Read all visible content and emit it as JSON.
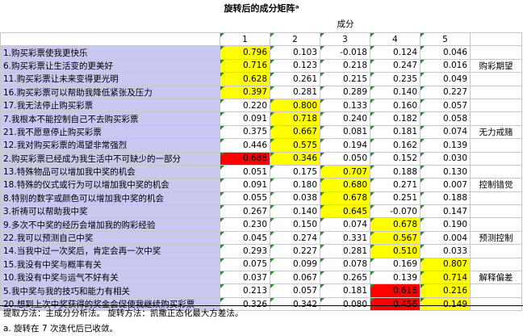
{
  "title": "旋转后的成分矩阵ᵃ",
  "group_header": "成分",
  "components": [
    "1",
    "2",
    "3",
    "4",
    "5"
  ],
  "groups": [
    {
      "name": "购彩期望",
      "rows": [
        {
          "label": "1.购买彩票使我更快乐",
          "values": [
            "0.796",
            "0.103",
            "-0.018",
            "0.124",
            "0.046"
          ],
          "highlight": [
            "y",
            "",
            "",
            "",
            ""
          ]
        },
        {
          "label": "6.购买彩票让生活变的更美好",
          "values": [
            "0.716",
            "0.123",
            "0.218",
            "0.247",
            "0.016"
          ],
          "highlight": [
            "y",
            "",
            "",
            "",
            ""
          ]
        },
        {
          "label": "11.购买彩票让未来变得更光明",
          "values": [
            "0.628",
            "0.261",
            "0.215",
            "0.235",
            "0.049"
          ],
          "highlight": [
            "y",
            "",
            "",
            "",
            ""
          ]
        },
        {
          "label": "16.购买彩票可以帮助我降低紧张及压力",
          "values": [
            "0.397",
            "0.281",
            "0.289",
            "0.140",
            "0.227"
          ],
          "highlight": [
            "y",
            "",
            "",
            "",
            ""
          ]
        }
      ]
    },
    {
      "name": "无力戒赌",
      "rows": [
        {
          "label": "17.我无法停止购买彩票",
          "values": [
            "0.220",
            "0.800",
            "0.133",
            "0.160",
            "0.057"
          ],
          "highlight": [
            "",
            "y",
            "",
            "",
            ""
          ]
        },
        {
          "label": "7.我根本不能控制自己不去购买彩票",
          "values": [
            "0.091",
            "0.718",
            "0.240",
            "0.182",
            "0.058"
          ],
          "highlight": [
            "",
            "y",
            "",
            "",
            ""
          ]
        },
        {
          "label": "21.我不愿意停止购买彩票",
          "values": [
            "0.375",
            "0.667",
            "0.081",
            "0.181",
            "0.074"
          ],
          "highlight": [
            "",
            "y",
            "",
            "",
            ""
          ]
        },
        {
          "label": "12.我对购买彩票的渴望非常强烈",
          "values": [
            "0.446",
            "0.575",
            "0.194",
            "0.162",
            "0.139"
          ],
          "highlight": [
            "",
            "y",
            "",
            "",
            ""
          ]
        },
        {
          "label": "2.购买彩票已经成为我生活中不可缺少的一部分",
          "values": [
            "0.688",
            "0.346",
            "0.050",
            "0.152",
            "0.030"
          ],
          "highlight": [
            "r",
            "y",
            "",
            "",
            ""
          ]
        }
      ]
    },
    {
      "name": "控制错觉",
      "rows": [
        {
          "label": "13.特殊物品可以增加我中奖的机会",
          "values": [
            "0.051",
            "0.175",
            "0.707",
            "0.188",
            "0.130"
          ],
          "highlight": [
            "",
            "",
            "y",
            "",
            ""
          ]
        },
        {
          "label": "18.特殊的仪式或行为可以增加我中奖的机会",
          "values": [
            "0.091",
            "0.180",
            "0.680",
            "0.271",
            "0.007"
          ],
          "highlight": [
            "",
            "",
            "y",
            "",
            ""
          ]
        },
        {
          "label": "8.特别的数字或颜色可以增加我中奖的机会",
          "values": [
            "0.055",
            "0.038",
            "0.678",
            "0.251",
            "0.188"
          ],
          "highlight": [
            "",
            "",
            "y",
            "",
            ""
          ]
        },
        {
          "label": "3.祈祷可以帮助我中奖",
          "values": [
            "0.267",
            "0.140",
            "0.645",
            "-0.070",
            "0.147"
          ],
          "highlight": [
            "",
            "",
            "y",
            "",
            ""
          ]
        }
      ]
    },
    {
      "name": "预测控制",
      "rows": [
        {
          "label": "9.多次不中奖的经历会增加我的购彩经验",
          "values": [
            "0.230",
            "0.150",
            "0.074",
            "0.678",
            "0.190"
          ],
          "highlight": [
            "",
            "",
            "",
            "y",
            ""
          ]
        },
        {
          "label": "22.我可以预测自己中奖",
          "values": [
            "0.045",
            "0.274",
            "0.331",
            "0.567",
            "0.004"
          ],
          "highlight": [
            "",
            "",
            "",
            "y",
            ""
          ]
        },
        {
          "label": "14.当我中过一次奖后，肯定会再一次中奖",
          "values": [
            "0.293",
            "0.227",
            "0.281",
            "0.510",
            "0.033"
          ],
          "highlight": [
            "",
            "",
            "",
            "y",
            ""
          ]
        }
      ]
    },
    {
      "name": "解释偏差",
      "rows": [
        {
          "label": "15.我没有中奖与概率有关",
          "values": [
            "0.075",
            "0.099",
            "0.078",
            "0.169",
            "0.807"
          ],
          "highlight": [
            "",
            "",
            "",
            "",
            "y"
          ]
        },
        {
          "label": "10.我没有中奖与运气不好有关",
          "values": [
            "0.037",
            "0.067",
            "0.265",
            "0.139",
            "0.714"
          ],
          "highlight": [
            "",
            "",
            "",
            "",
            "y"
          ]
        },
        {
          "label": "5.我中奖与我的技巧和能力有相关",
          "values": [
            "0.213",
            "0.057",
            "0.181",
            "0.618",
            "0.216"
          ],
          "highlight": [
            "",
            "",
            "",
            "r",
            "y"
          ]
        },
        {
          "label": "20.想到上次中奖获得的奖金会促使我继续购买彩票",
          "values": [
            "0.326",
            "0.342",
            "0.080",
            "0.456",
            "0.149"
          ],
          "highlight": [
            "",
            "",
            "",
            "r",
            "y"
          ]
        }
      ]
    }
  ],
  "footer": {
    "line1": "提取方法：主成分分析法。  旋转方法：凯撒正态化最大方差法。",
    "line2": "a. 旋转在 7 次迭代后已收敛。"
  }
}
